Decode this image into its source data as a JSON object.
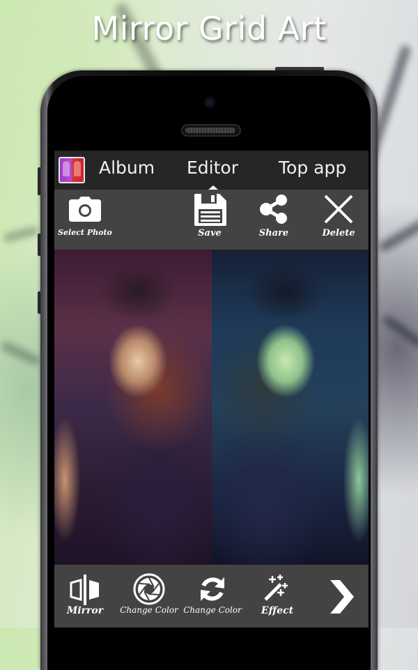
{
  "promo": {
    "title": "Mirror Grid Art"
  },
  "app": {
    "tabs": [
      {
        "label": "Album",
        "active": false
      },
      {
        "label": "Editor",
        "active": true
      },
      {
        "label": "Top app",
        "active": false
      }
    ],
    "toolbar": {
      "select_photo": {
        "label": "Select Photo",
        "icon": "camera-icon"
      },
      "save": {
        "label": "Save",
        "icon": "floppy-disk-icon"
      },
      "share": {
        "label": "Share",
        "icon": "share-icon"
      },
      "delete": {
        "label": "Delete",
        "icon": "close-icon"
      }
    },
    "canvas": {
      "description": "Mirrored portrait, left half warm/magenta tint, right half cool/green tint"
    },
    "bottom_toolbar": {
      "items": [
        {
          "label": "Mirror",
          "icon": "mirror-icon"
        },
        {
          "label": "Change Color",
          "icon": "aperture-icon"
        },
        {
          "label": "Change Color",
          "icon": "refresh-icon"
        },
        {
          "label": "Effect",
          "icon": "magic-wand-icon"
        },
        {
          "label": "",
          "icon": "chevron-right-icon"
        }
      ]
    }
  },
  "colors": {
    "tabbar_bg": "#262626",
    "toolbar_bg": "#434343",
    "text": "#ffffff"
  }
}
